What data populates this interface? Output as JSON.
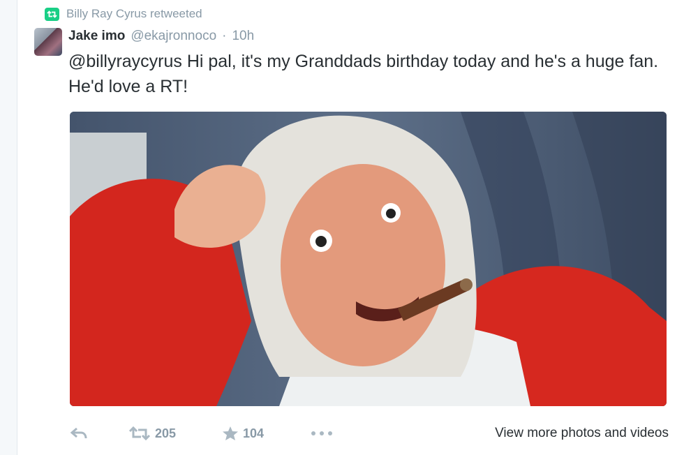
{
  "context": {
    "text": "Billy Ray Cyrus retweeted",
    "icon": "retweet-icon",
    "badge_color": "#19cf86"
  },
  "tweet": {
    "fullname": "Jake imo",
    "handle": "@ekajronnoco",
    "separator": "·",
    "time": "10h",
    "text": "@billyraycyrus Hi pal, it's my Granddads birthday today and he's a huge fan. He'd love a RT!",
    "media": {
      "kind": "photo",
      "description_icon": "photo"
    }
  },
  "actions": {
    "reply_icon": "reply-icon",
    "retweet_icon": "retweet-icon",
    "retweet_count": "205",
    "favorite_icon": "star-icon",
    "favorite_count": "104",
    "more_icon": "more-icon",
    "view_more": "View more photos and videos"
  },
  "colors": {
    "muted": "#8899a6",
    "text": "#292f33",
    "accent": "#19cf86"
  }
}
